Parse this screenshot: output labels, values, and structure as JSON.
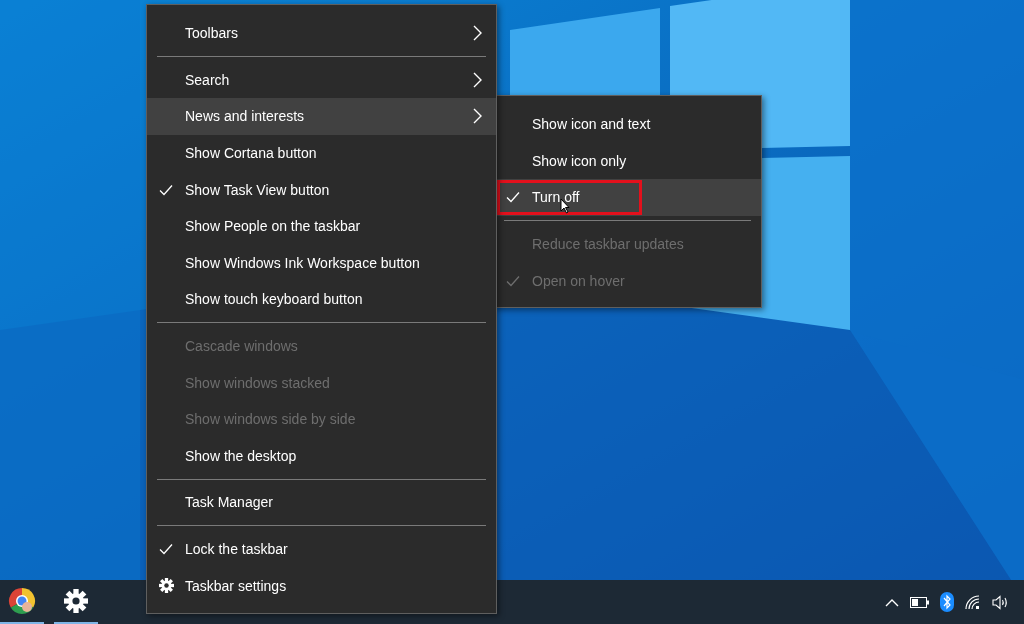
{
  "context_menu": {
    "items": [
      {
        "kind": "item",
        "label": "Toolbars",
        "checked": false,
        "disabled": false,
        "selected": false,
        "submenu": true
      },
      {
        "kind": "separator"
      },
      {
        "kind": "item",
        "label": "Search",
        "checked": false,
        "disabled": false,
        "selected": false,
        "submenu": true
      },
      {
        "kind": "item",
        "label": "News and interests",
        "checked": false,
        "disabled": false,
        "selected": true,
        "submenu": true
      },
      {
        "kind": "item",
        "label": "Show Cortana button",
        "checked": false,
        "disabled": false,
        "selected": false,
        "submenu": false
      },
      {
        "kind": "item",
        "label": "Show Task View button",
        "checked": true,
        "disabled": false,
        "selected": false,
        "submenu": false
      },
      {
        "kind": "item",
        "label": "Show People on the taskbar",
        "checked": false,
        "disabled": false,
        "selected": false,
        "submenu": false
      },
      {
        "kind": "item",
        "label": "Show Windows Ink Workspace button",
        "checked": false,
        "disabled": false,
        "selected": false,
        "submenu": false
      },
      {
        "kind": "item",
        "label": "Show touch keyboard button",
        "checked": false,
        "disabled": false,
        "selected": false,
        "submenu": false
      },
      {
        "kind": "separator"
      },
      {
        "kind": "item",
        "label": "Cascade windows",
        "checked": false,
        "disabled": true,
        "selected": false,
        "submenu": false
      },
      {
        "kind": "item",
        "label": "Show windows stacked",
        "checked": false,
        "disabled": true,
        "selected": false,
        "submenu": false
      },
      {
        "kind": "item",
        "label": "Show windows side by side",
        "checked": false,
        "disabled": true,
        "selected": false,
        "submenu": false
      },
      {
        "kind": "item",
        "label": "Show the desktop",
        "checked": false,
        "disabled": false,
        "selected": false,
        "submenu": false
      },
      {
        "kind": "separator"
      },
      {
        "kind": "item",
        "label": "Task Manager",
        "checked": false,
        "disabled": false,
        "selected": false,
        "submenu": false
      },
      {
        "kind": "separator"
      },
      {
        "kind": "item",
        "label": "Lock the taskbar",
        "checked": true,
        "disabled": false,
        "selected": false,
        "submenu": false
      },
      {
        "kind": "settings-item",
        "label": "Taskbar settings",
        "checked": false,
        "disabled": false,
        "selected": false,
        "submenu": false
      }
    ]
  },
  "submenu": {
    "items": [
      {
        "kind": "item",
        "label": "Show icon and text",
        "checked": false,
        "disabled": false,
        "selected": false,
        "annotated": false
      },
      {
        "kind": "item",
        "label": "Show icon only",
        "checked": false,
        "disabled": false,
        "selected": false,
        "annotated": false
      },
      {
        "kind": "item",
        "label": "Turn off",
        "checked": true,
        "disabled": false,
        "selected": true,
        "annotated": true
      },
      {
        "kind": "separator"
      },
      {
        "kind": "item",
        "label": "Reduce taskbar updates",
        "checked": false,
        "disabled": true,
        "selected": false,
        "annotated": false
      },
      {
        "kind": "item",
        "label": "Open on hover",
        "checked": true,
        "disabled": true,
        "selected": false,
        "annotated": false
      }
    ]
  },
  "taskbar": {
    "apps": [
      {
        "kind": "browser",
        "running": true
      },
      {
        "kind": "settings",
        "running": true
      }
    ]
  }
}
